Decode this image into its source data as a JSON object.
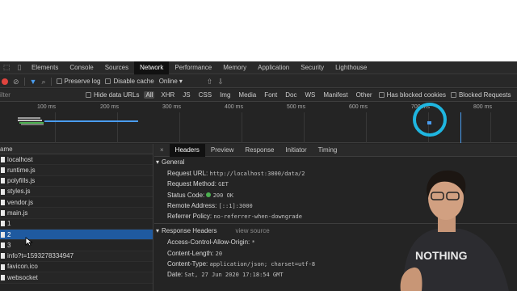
{
  "devtools": {
    "tabs": [
      "Elements",
      "Console",
      "Sources",
      "Network",
      "Performance",
      "Memory",
      "Application",
      "Security",
      "Lighthouse"
    ],
    "active_tab": "Network"
  },
  "toolbar": {
    "preserve_log": "Preserve log",
    "disable_cache": "Disable cache",
    "throttle": "Online"
  },
  "filterbar": {
    "filter_placeholder": "ilter",
    "hide_data_urls": "Hide data URLs",
    "types": [
      "All",
      "XHR",
      "JS",
      "CSS",
      "Img",
      "Media",
      "Font",
      "Doc",
      "WS",
      "Manifest",
      "Other"
    ],
    "has_blocked_cookies": "Has blocked cookies",
    "blocked_requests": "Blocked Requests"
  },
  "timeline": {
    "ticks": [
      "100 ms",
      "200 ms",
      "300 ms",
      "400 ms",
      "500 ms",
      "600 ms",
      "700 ms",
      "800 ms"
    ]
  },
  "namelist": {
    "header": "ame",
    "rows": [
      "localhost",
      "runtime.js",
      "polyfills.js",
      "styles.js",
      "vendor.js",
      "main.js",
      "1",
      "2",
      "3",
      "info?t=1593278334947",
      "favicon.ico",
      "websocket"
    ]
  },
  "details": {
    "tabs": [
      "Headers",
      "Preview",
      "Response",
      "Initiator",
      "Timing"
    ],
    "general_title": "General",
    "general": [
      {
        "key": "Request URL:",
        "value": "http://localhost:3000/data/2"
      },
      {
        "key": "Request Method:",
        "value": "GET"
      },
      {
        "key": "Status Code:",
        "value": "200 OK"
      },
      {
        "key": "Remote Address:",
        "value": "[::1]:3000"
      },
      {
        "key": "Referrer Policy:",
        "value": "no-referrer-when-downgrade"
      }
    ],
    "response_title": "Response Headers",
    "view_source": "view source",
    "response": [
      {
        "key": "Access-Control-Allow-Origin:",
        "value": "*"
      },
      {
        "key": "Content-Length:",
        "value": "20"
      },
      {
        "key": "Content-Type:",
        "value": "application/json; charset=utf-8"
      },
      {
        "key": "Date:",
        "value": "Sat, 27 Jun 2020 17:18:54 GMT"
      }
    ]
  },
  "overlay": {
    "shirt_text": "NOTHING"
  }
}
